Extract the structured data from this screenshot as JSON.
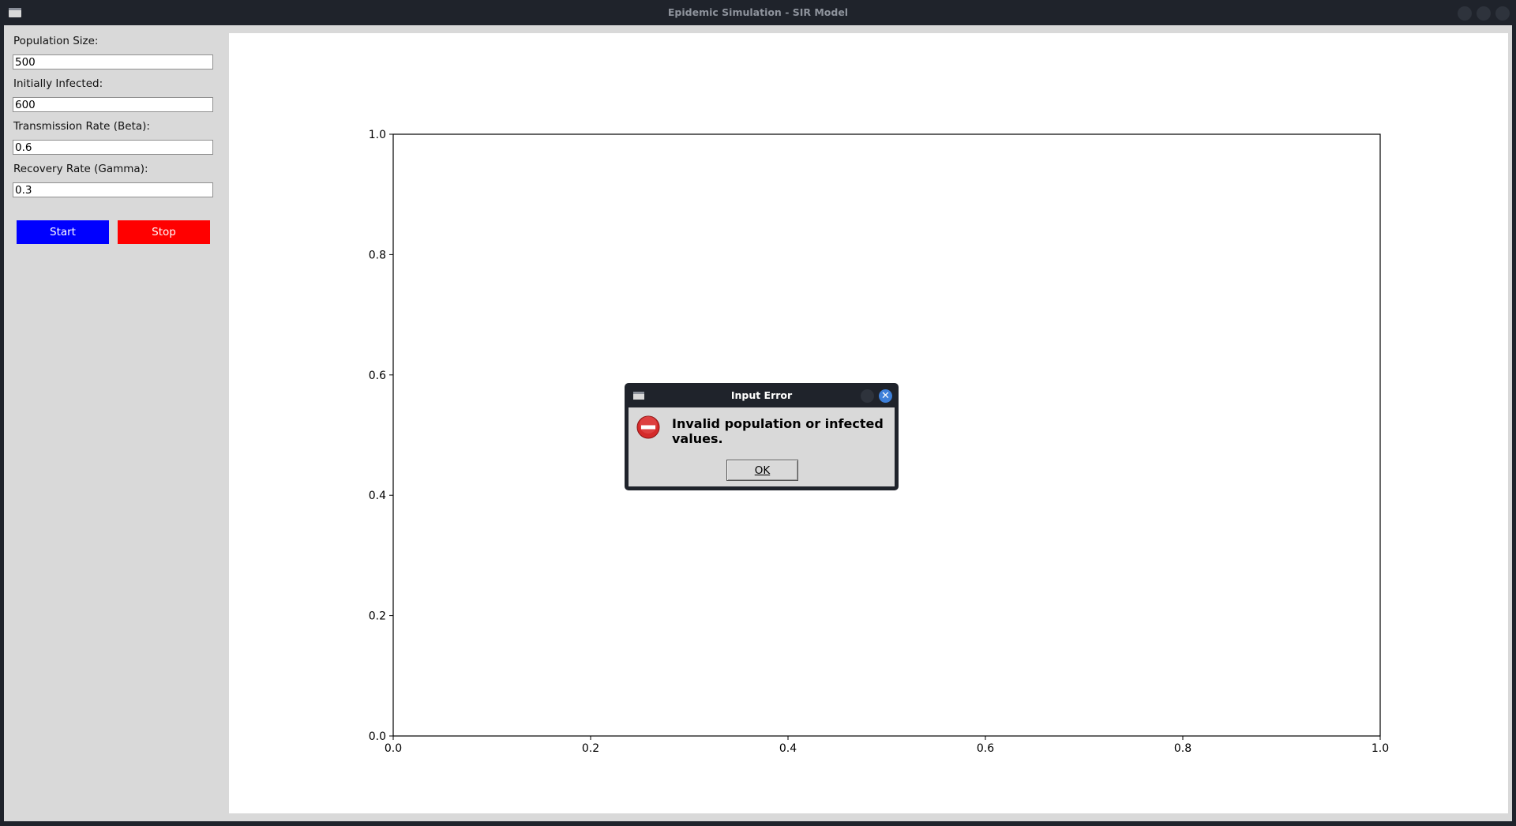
{
  "window": {
    "title": "Epidemic Simulation - SIR Model"
  },
  "sidebar": {
    "fields": [
      {
        "label": "Population Size:",
        "value": "500"
      },
      {
        "label": "Initially Infected:",
        "value": "600"
      },
      {
        "label": "Transmission Rate (Beta):",
        "value": "0.6"
      },
      {
        "label": "Recovery Rate (Gamma):",
        "value": "0.3"
      }
    ],
    "start_label": "Start",
    "stop_label": "Stop",
    "colors": {
      "start": "#0000ff",
      "stop": "#ff0000"
    }
  },
  "chart_data": {
    "type": "line",
    "series": [],
    "xlim": [
      0.0,
      1.0
    ],
    "ylim": [
      0.0,
      1.0
    ],
    "x_ticks": [
      "0.0",
      "0.2",
      "0.4",
      "0.6",
      "0.8",
      "1.0"
    ],
    "y_ticks": [
      "0.0",
      "0.2",
      "0.4",
      "0.6",
      "0.8",
      "1.0"
    ],
    "title": "",
    "xlabel": "",
    "ylabel": "",
    "grid": false
  },
  "dialog": {
    "title": "Input Error",
    "message": "Invalid population or infected values.",
    "ok_label": "OK",
    "icon": "error-icon"
  }
}
